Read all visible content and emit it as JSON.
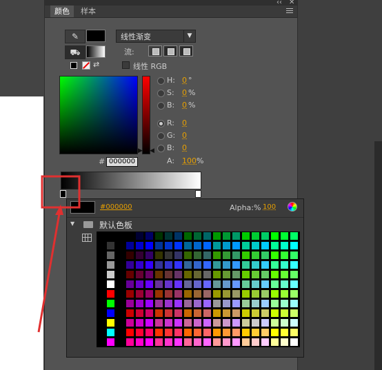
{
  "panel": {
    "tabs": [
      {
        "label": "颜色"
      },
      {
        "label": "样本"
      }
    ]
  },
  "fill": {
    "type_label": "线性渐变",
    "flow_label": "流:",
    "linear_rgb_label": "线性 RGB"
  },
  "color": {
    "H": {
      "label": "H:",
      "value": "0",
      "unit": "°"
    },
    "S": {
      "label": "S:",
      "value": "0",
      "unit": "%"
    },
    "B": {
      "label": "B:",
      "value": "0",
      "unit": "%"
    },
    "R": {
      "label": "R:",
      "value": "0"
    },
    "G": {
      "label": "G:",
      "value": "0"
    },
    "Bl": {
      "label": "B:",
      "value": "0"
    },
    "A": {
      "label": "A:",
      "value": "100",
      "unit": "%"
    },
    "hex_prefix": "#",
    "hex": "000000"
  },
  "popup": {
    "hex": "#000000",
    "alpha_label": "Alpha:%",
    "alpha_value": "100",
    "folder_label": "默认色板"
  },
  "colors": {
    "accent_value": "#e8a000",
    "annotation": "#e03030"
  }
}
